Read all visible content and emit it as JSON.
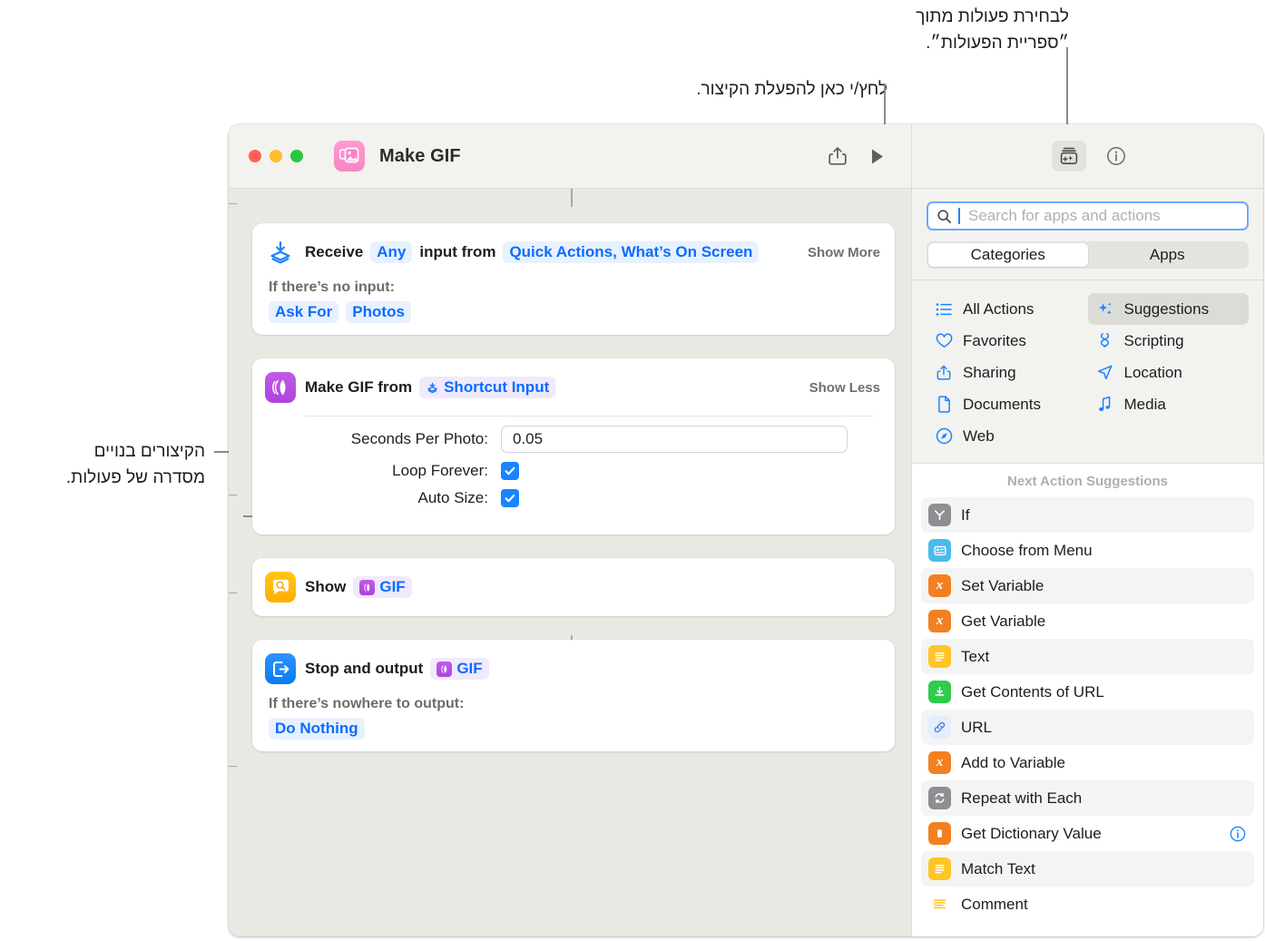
{
  "annotations": {
    "library": "לבחירת פעולות מתוך\n״ספריית הפעולות״.",
    "run": "לחץ/י כאן להפעלת הקיצור.",
    "builtin": "הקיצורים בנויים\nמסדרה של פעולות."
  },
  "window": {
    "title": "Make GIF",
    "app_icon": "photos-icon",
    "toolbar": {
      "share_icon": "share-icon",
      "run_icon": "play-icon",
      "library_icon": "action-library-icon",
      "info_icon": "info-icon"
    }
  },
  "editor": {
    "actions": [
      {
        "id": "receive",
        "icon": "receive-input-icon",
        "icon_color": "#1a84ff",
        "title_prefix": "Receive",
        "type_chip": "Any",
        "title_middle": "input from",
        "source_chip": "Quick Actions, What’s On Screen",
        "toggle": "Show More",
        "sub_label": "If there’s no input:",
        "sub_chips": [
          "Ask For",
          "Photos"
        ]
      },
      {
        "id": "make-gif",
        "icon": "make-gif-icon",
        "icon_color": "#b44ce0",
        "title_prefix": "Make GIF from",
        "var_chip": "Shortcut Input",
        "toggle": "Show Less",
        "params": [
          {
            "label": "Seconds Per Photo:",
            "type": "text",
            "value": "0.05"
          },
          {
            "label": "Loop Forever:",
            "type": "checkbox",
            "checked": true
          },
          {
            "label": "Auto Size:",
            "type": "checkbox",
            "checked": true
          }
        ]
      },
      {
        "id": "show",
        "icon": "quick-look-icon",
        "icon_color": "#ffb800",
        "title_prefix": "Show",
        "var_chip": "GIF"
      },
      {
        "id": "stop-and-output",
        "icon": "stop-output-icon",
        "icon_color": "#1a84ff",
        "title_prefix": "Stop and output",
        "var_chip": "GIF",
        "sub_label": "If there’s nowhere to output:",
        "sub_chips": [
          "Do Nothing"
        ]
      }
    ]
  },
  "sidebar": {
    "search": {
      "placeholder": "Search for apps and actions",
      "value": "",
      "icon": "search-icon"
    },
    "segmented": {
      "options": [
        "Categories",
        "Apps"
      ],
      "selected": "Categories"
    },
    "categories_left": [
      {
        "label": "All Actions",
        "icon": "list-icon"
      },
      {
        "label": "Favorites",
        "icon": "heart-icon"
      },
      {
        "label": "Sharing",
        "icon": "share-icon"
      },
      {
        "label": "Documents",
        "icon": "document-icon"
      },
      {
        "label": "Web",
        "icon": "safari-icon"
      }
    ],
    "categories_right": [
      {
        "label": "Suggestions",
        "icon": "sparkles-icon",
        "selected": true
      },
      {
        "label": "Scripting",
        "icon": "scripting-icon"
      },
      {
        "label": "Location",
        "icon": "location-arrow-icon"
      },
      {
        "label": "Media",
        "icon": "music-note-icon"
      }
    ],
    "suggestions_header": "Next Action Suggestions",
    "suggestions": [
      {
        "label": "If",
        "icon": "if-icon",
        "icon_color": "#8e8e93",
        "info": false
      },
      {
        "label": "Choose from Menu",
        "icon": "menu-icon",
        "icon_color": "#4cb9ef",
        "info": false
      },
      {
        "label": "Set Variable",
        "icon": "variable-icon",
        "icon_color": "#f38020",
        "info": false
      },
      {
        "label": "Get Variable",
        "icon": "variable-icon",
        "icon_color": "#f38020",
        "info": false
      },
      {
        "label": "Text",
        "icon": "text-icon",
        "icon_color": "#ffc426",
        "info": false
      },
      {
        "label": "Get Contents of URL",
        "icon": "download-icon",
        "icon_color": "#2ecc4a",
        "info": false
      },
      {
        "label": "URL",
        "icon": "link-icon",
        "icon_color": "#e4edfb",
        "info": false
      },
      {
        "label": "Add to Variable",
        "icon": "variable-icon",
        "icon_color": "#f38020",
        "info": false
      },
      {
        "label": "Repeat with Each",
        "icon": "repeat-icon",
        "icon_color": "#8e8e93",
        "info": false
      },
      {
        "label": "Get Dictionary Value",
        "icon": "dictionary-icon",
        "icon_color": "#f38020",
        "info": true
      },
      {
        "label": "Match Text",
        "icon": "text-icon",
        "icon_color": "#ffc426",
        "info": false
      },
      {
        "label": "Comment",
        "icon": "comment-icon",
        "icon_color": "#ffc426",
        "info": false
      }
    ]
  },
  "colors": {
    "accent": "#0a6cff",
    "window_bg": "#e9e9e4",
    "chrome": "#f2f2ef"
  }
}
